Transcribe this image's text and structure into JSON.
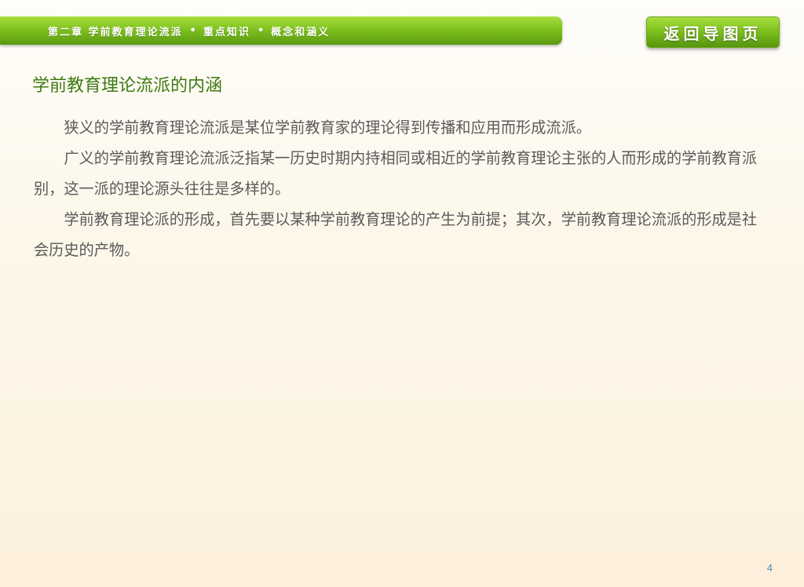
{
  "header": {
    "chapter": "第二章 学前教育理论流派",
    "section": "重点知识",
    "topic": "概念和涵义",
    "separator": "•"
  },
  "back_button": {
    "label": "返回导图页"
  },
  "title": "学前教育理论流派的内涵",
  "paragraphs": [
    "狭义的学前教育理论流派是某位学前教育家的理论得到传播和应用而形成流派。",
    "广义的学前教育理论流派泛指某一历史时期内持相同或相近的学前教育理论主张的人而形成的学前教育派别，这一派的理论源头往往是多样的。",
    "学前教育理论派的形成，首先要以某种学前教育理论的产生为前提；其次，学前教育理论流派的形成是社会历史的产物。"
  ],
  "page_number": "4",
  "colors": {
    "accent_green": "#7fc21f",
    "title_green": "#3f7a10",
    "body_text": "#5a5a5a",
    "page_number": "#4a8fc2"
  }
}
